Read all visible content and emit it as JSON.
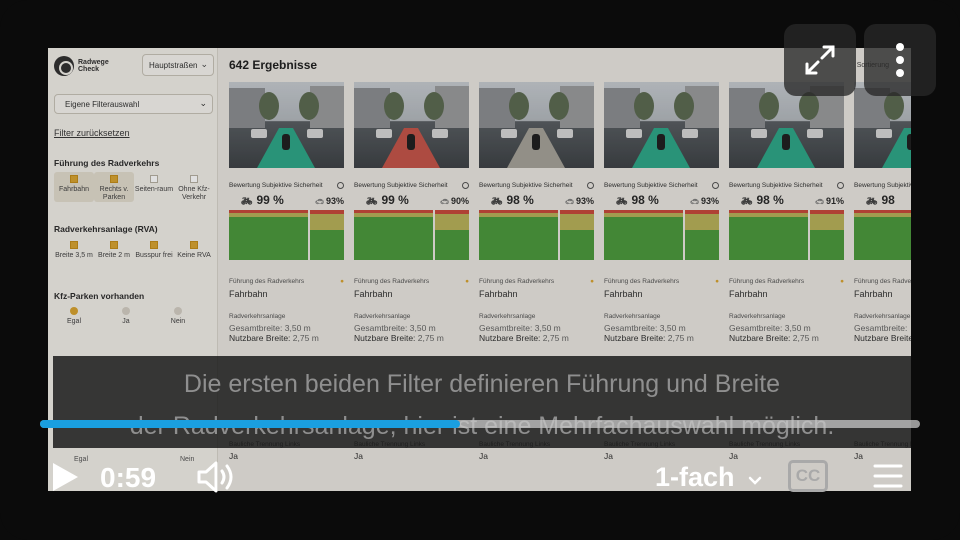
{
  "app": {
    "logo_text": "Radwege Check",
    "road_type": "Hauptstraßen",
    "filter_preset": "Eigene Filterauswahl",
    "reset_link": "Filter zurücksetzen",
    "sections": [
      {
        "title": "Führung des Radverkehrs",
        "options": [
          {
            "label": "Fahrbahn",
            "checked": true
          },
          {
            "label": "Rechts v. Parken",
            "checked": true
          },
          {
            "label": "Seiten-raum",
            "checked": false
          },
          {
            "label": "Ohne Kfz-Verkehr",
            "checked": false
          }
        ]
      },
      {
        "title": "Radverkehrsanlage (RVA)",
        "options": [
          {
            "label": "Breite 3,5 m",
            "checked": true
          },
          {
            "label": "Breite 2 m",
            "checked": true
          },
          {
            "label": "Busspur frei",
            "checked": true
          },
          {
            "label": "Keine RVA",
            "checked": true
          }
        ]
      },
      {
        "title": "Kfz-Parken vorhanden",
        "options": [
          {
            "label": "Egal",
            "checked": true
          },
          {
            "label": "Ja",
            "checked": false
          },
          {
            "label": "Nein",
            "checked": false
          }
        ]
      }
    ],
    "bottom_left_labels": [
      "Egal",
      "Nein"
    ],
    "results_title": "642 Ergebnisse",
    "sort_label": "Sortierung",
    "card_rating_title": "Bewertung Subjektive Sicherheit",
    "card_fuehrung_label": "Führung des Radverkehrs",
    "card_anlage_label": "Radverkehrsanlage",
    "card_gesamt_label": "Gesamtbreite:",
    "card_nutzbar_label": "Nutzbare Breite:",
    "card_trennung_label": "Bauliche Trennung Links",
    "cards": [
      {
        "bike_pct": "99 %",
        "car_pct": "93%",
        "fuehrung": "Fahrbahn",
        "gesamt": "3,50 m",
        "nutzbar": "2,75 m",
        "trennung": "Ja",
        "lane": "green"
      },
      {
        "bike_pct": "99 %",
        "car_pct": "90%",
        "fuehrung": "Fahrbahn",
        "gesamt": "3,50 m",
        "nutzbar": "2,75 m",
        "trennung": "Ja",
        "lane": "red"
      },
      {
        "bike_pct": "98 %",
        "car_pct": "93%",
        "fuehrung": "Fahrbahn",
        "gesamt": "3,50 m",
        "nutzbar": "2,75 m",
        "trennung": "Ja",
        "lane": "grey"
      },
      {
        "bike_pct": "98 %",
        "car_pct": "93%",
        "fuehrung": "Fahrbahn",
        "gesamt": "3,50 m",
        "nutzbar": "2,75 m",
        "trennung": "Ja",
        "lane": "green"
      },
      {
        "bike_pct": "98 %",
        "car_pct": "91%",
        "fuehrung": "Fahrbahn",
        "gesamt": "3,50 m",
        "nutzbar": "2,75 m",
        "trennung": "Ja",
        "lane": "green"
      },
      {
        "bike_pct": "98",
        "car_pct": "",
        "fuehrung": "Fahrbahn",
        "gesamt": "",
        "nutzbar": "",
        "trennung": "Ja",
        "lane": "green"
      }
    ]
  },
  "caption": {
    "line1": "Die ersten beiden Filter definieren Führung und Breite",
    "line2": "der Radverkehrsanlage, hier ist eine Mehrfachauswahl möglich."
  },
  "player": {
    "current_time": "0:59",
    "progress_fraction": 0.477,
    "speed_label": "1-fach",
    "cc_label": "CC",
    "accent_color": "#1a9fe0"
  }
}
